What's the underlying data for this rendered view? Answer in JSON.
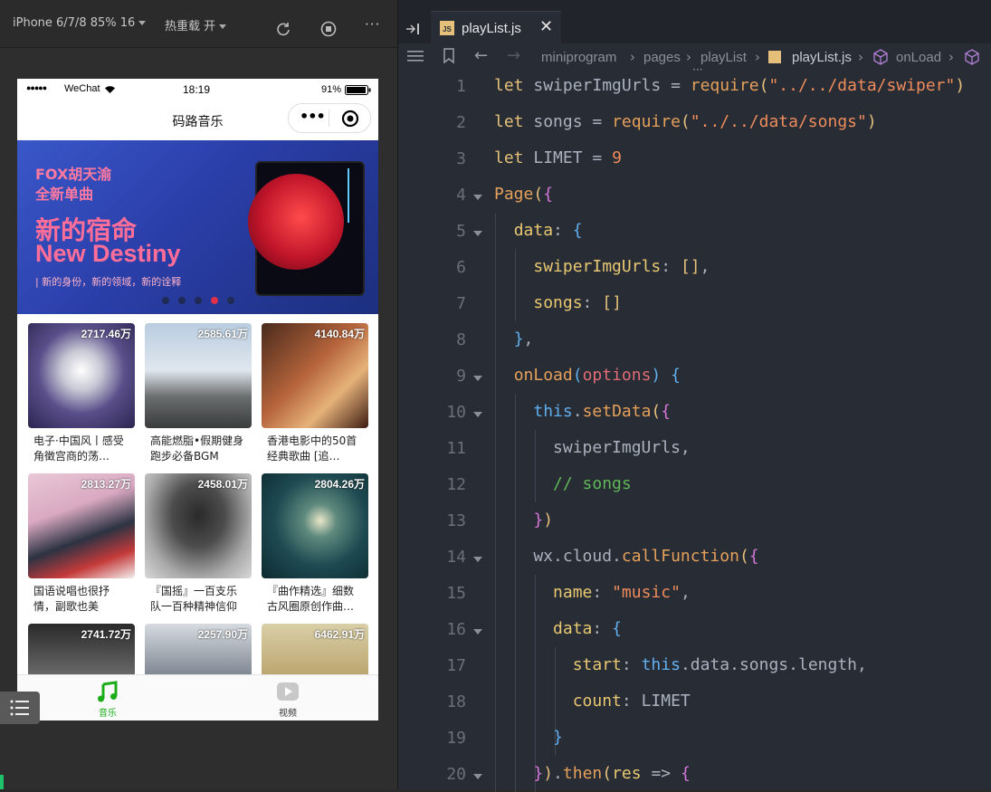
{
  "simulator": {
    "device_label": "iPhone 6/7/8 85% 16",
    "hot_reload_label": "热重载 开",
    "more_label": "···"
  },
  "phone": {
    "status": {
      "carrier": "WeChat",
      "time": "18:19",
      "battery": "91%"
    },
    "nav_title": "码路音乐",
    "banner": {
      "tag_line1": "FOX胡天渝",
      "tag_line2": "全新单曲",
      "title_cn": "新的宿命",
      "title_en": "New Destiny",
      "subtitle": "| 新的身份，新的领域，新的诠释",
      "dots": 5,
      "active_dot": 3
    },
    "grid": [
      {
        "plays": "2717.46万",
        "title": "电子·中国风丨感受角徵宫商的荡…"
      },
      {
        "plays": "2585.61万",
        "title": "高能燃脂•假期健身跑步必备BGM"
      },
      {
        "plays": "4140.84万",
        "title": "香港电影中的50首经典歌曲 [追…"
      },
      {
        "plays": "2813.27万",
        "title": "国语说唱也很抒情，副歌也美"
      },
      {
        "plays": "2458.01万",
        "title": "『国摇』一百支乐队一百种精神信仰"
      },
      {
        "plays": "2804.26万",
        "title": "『曲作精选』细数古风圈原创作曲…"
      },
      {
        "plays": "2741.72万",
        "title": ""
      },
      {
        "plays": "2257.90万",
        "title": ""
      },
      {
        "plays": "6462.91万",
        "title": ""
      }
    ],
    "tabs": [
      {
        "label": "音乐",
        "color": "#1aad19"
      },
      {
        "label": "视频",
        "color": "#333333"
      }
    ]
  },
  "editor": {
    "tab_label": "playList.js",
    "tab_icon_text": "JS",
    "breadcrumb": [
      "miniprogram",
      "pages",
      "playList",
      "playList.js",
      "onLoad"
    ],
    "lines": [
      "1",
      "2",
      "3",
      "4",
      "5",
      "6",
      "7",
      "8",
      "9",
      "10",
      "11",
      "12",
      "13",
      "14",
      "15",
      "16",
      "17",
      "18",
      "19",
      "20"
    ]
  }
}
